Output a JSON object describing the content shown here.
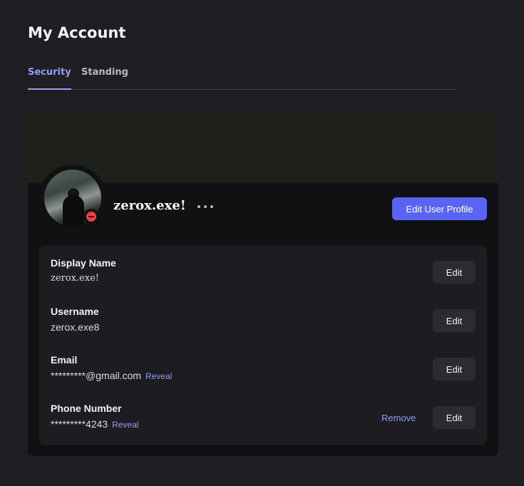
{
  "page": {
    "title": "My Account"
  },
  "tabs": [
    {
      "label": "Security",
      "active": true
    },
    {
      "label": "Standing",
      "active": false
    }
  ],
  "profile": {
    "display_name": "zerox.exe!",
    "status": "do-not-disturb",
    "edit_button_label": "Edit User Profile",
    "more_icon": "ellipsis-icon"
  },
  "fields": {
    "display_name": {
      "label": "Display Name",
      "value": "zerox.exe!",
      "edit_label": "Edit"
    },
    "username": {
      "label": "Username",
      "value": "zerox.exe8",
      "edit_label": "Edit"
    },
    "email": {
      "label": "Email",
      "value": "*********@gmail.com",
      "reveal_label": "Reveal",
      "edit_label": "Edit"
    },
    "phone": {
      "label": "Phone Number",
      "value": "*********4243",
      "reveal_label": "Reveal",
      "remove_label": "Remove",
      "edit_label": "Edit"
    }
  },
  "colors": {
    "accent": "#5865f2",
    "link": "#949cf7",
    "status_dnd": "#f23f43",
    "background": "#1f1f23"
  }
}
